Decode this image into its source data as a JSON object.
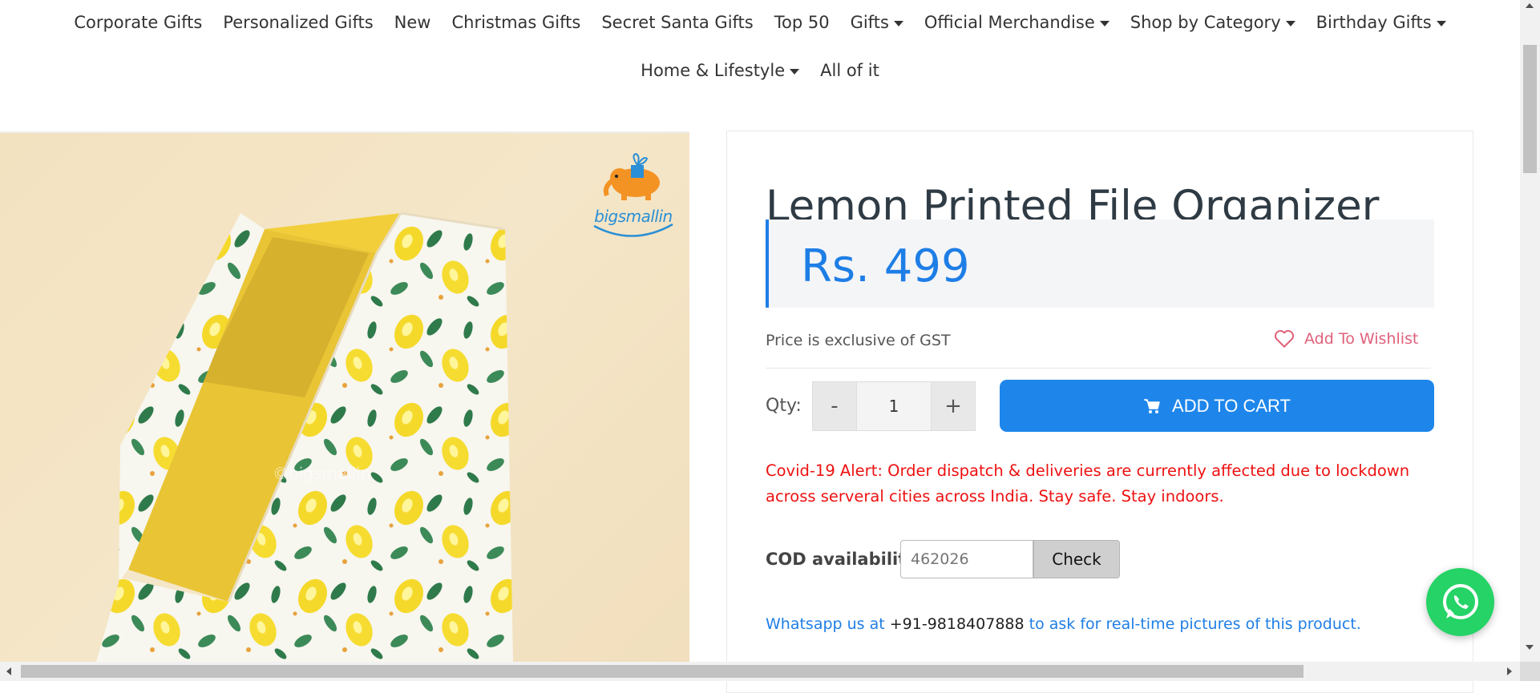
{
  "nav": {
    "row1": [
      {
        "label": "Corporate Gifts",
        "dropdown": false
      },
      {
        "label": "Personalized Gifts",
        "dropdown": false
      },
      {
        "label": "New",
        "dropdown": false
      },
      {
        "label": "Christmas Gifts",
        "dropdown": false
      },
      {
        "label": "Secret Santa Gifts",
        "dropdown": false
      },
      {
        "label": "Top 50",
        "dropdown": false
      },
      {
        "label": "Gifts",
        "dropdown": true
      },
      {
        "label": "Official Merchandise",
        "dropdown": true
      },
      {
        "label": "Shop by Category",
        "dropdown": true
      },
      {
        "label": "Birthday Gifts",
        "dropdown": true
      }
    ],
    "row2": [
      {
        "label": "Home & Lifestyle",
        "dropdown": true
      },
      {
        "label": "All of it",
        "dropdown": false
      }
    ]
  },
  "image": {
    "logo_text": "bigsmallin",
    "watermark": "©bigsmallin"
  },
  "product": {
    "title": "Lemon Printed File Organizer",
    "price": "Rs. 499",
    "gst_note": "Price is exclusive of GST",
    "wishlist_label": "Add To Wishlist",
    "qty_label": "Qty:",
    "qty_minus": "-",
    "qty_value": "1",
    "qty_plus": "+",
    "add_to_cart_label": "ADD TO CART",
    "alert": "Covid-19 Alert: Order dispatch & deliveries are currently affected due to lockdown across serveral cities across India. Stay safe. Stay indoors.",
    "cod_label": "COD availability",
    "cod_placeholder": "462026",
    "check_label": "Check",
    "whatsapp_prefix": "Whatsapp us at ",
    "whatsapp_phone": "+91-9818407888",
    "whatsapp_suffix": " to ask for real-time pictures of this product."
  },
  "colors": {
    "accent": "#1e86eb",
    "price": "#1e7ee6",
    "alert": "#ee1111",
    "wishlist": "#e0607a",
    "whatsapp": "#25d366"
  }
}
